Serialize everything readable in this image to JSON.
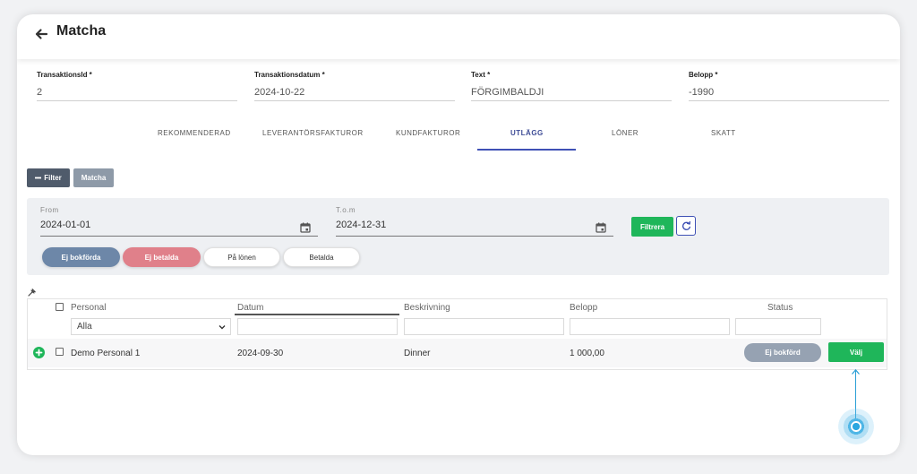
{
  "header": {
    "title": "Matcha",
    "back_icon": "arrow-left-icon"
  },
  "transaction_fields": [
    {
      "label": "TransaktionsId *",
      "value": "2"
    },
    {
      "label": "Transaktionsdatum *",
      "value": "2024-10-22"
    },
    {
      "label": "Text *",
      "value": "FÖRGIMBALDJI"
    },
    {
      "label": "Belopp *",
      "value": "-1990"
    }
  ],
  "tabs": [
    {
      "label": "REKOMMENDERAD",
      "active": false
    },
    {
      "label": "LEVERANTÖRSFAKTUROR",
      "active": false
    },
    {
      "label": "KUNDFAKTUROR",
      "active": false
    },
    {
      "label": "UTLÄGG",
      "active": true
    },
    {
      "label": "LÖNER",
      "active": false
    },
    {
      "label": "SKATT",
      "active": false
    }
  ],
  "toolbar": {
    "filter_label": "Filter",
    "matcha_label": "Matcha"
  },
  "filter_panel": {
    "from_label": "From",
    "from_value": "2024-01-01",
    "tom_label": "T.o.m",
    "tom_value": "2024-12-31",
    "filtrera_label": "Filtrera",
    "chips": [
      "Ej bokförda",
      "Ej betalda",
      "På lönen",
      "Betalda"
    ]
  },
  "table": {
    "headers": [
      "Personal",
      "Datum",
      "Beskrivning",
      "Belopp",
      "Status"
    ],
    "personal_filter": "Alla",
    "rows": [
      {
        "personal": "Demo Personal 1",
        "datum": "2024-09-30",
        "beskrivning": "Dinner",
        "belopp": "1 000,00",
        "status": "Ej bokförd",
        "action": "Välj"
      }
    ]
  },
  "colors": {
    "primary_blue": "#3f51b5",
    "green": "#1fb65a",
    "dark_slate": "#4f5b6b",
    "chip_blue": "#6d87a8",
    "chip_red": "#e0808a"
  }
}
